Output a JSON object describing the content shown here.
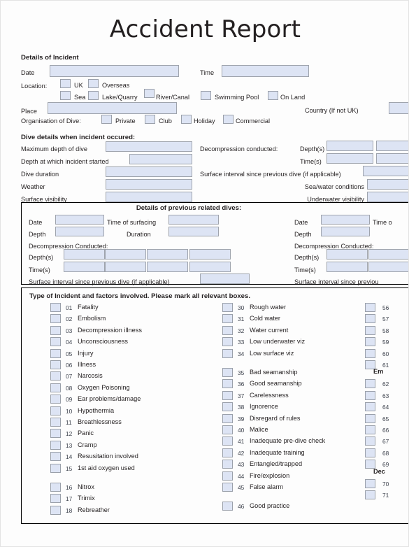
{
  "document": {
    "title": "Accident Report"
  },
  "sections": {
    "incident": {
      "heading": "Details of Incident",
      "date_label": "Date",
      "time_label": "Time",
      "location_label": "Location:",
      "location_options_row1": [
        "UK",
        "Overseas"
      ],
      "location_options_row2": [
        "Sea",
        "Lake/Quarry",
        "River/Canal",
        "Swimming Pool",
        "On Land"
      ],
      "place_label": "Place",
      "country_label": "Country (If not UK)",
      "organisation_label": "Organisation of Dive:",
      "organisation_options": [
        "Private",
        "Club",
        "Holiday",
        "Commercial"
      ]
    },
    "dive_details": {
      "heading": "Dive details when incident occured:",
      "left_labels": [
        "Maximum depth of dive",
        "Depth at which incident started",
        "Dive duration",
        "Weather",
        "Surface visibility"
      ],
      "right_labels": [
        "Decompression conducted:",
        "Depth(s)",
        "Time(s)",
        "Surface interval since previous dive (if applicable)",
        "Sea/water conditions",
        "Underwater visibility"
      ]
    },
    "previous_dives": {
      "heading": "Details of previous related dives:",
      "date_label": "Date",
      "time_of_surfacing_label": "Time of surfacing",
      "time_of_surfacing_label_clipped": "Time o",
      "depth_label": "Depth",
      "duration_label": "Duration",
      "decompression_label": "Decompression Conducted:",
      "depths_label": "Depth(s)",
      "times_label": "Time(s)",
      "surface_interval_label": "Surface interval since previous dive (if applicable)",
      "surface_interval_label_clipped": "Surface interval since previou"
    },
    "incident_types": {
      "heading": "Type of Incident and factors involved. Please mark all relevant boxes.",
      "column1": [
        {
          "num": "01",
          "label": "Fatality"
        },
        {
          "num": "02",
          "label": "Embolism"
        },
        {
          "num": "03",
          "label": "Decompression illness"
        },
        {
          "num": "04",
          "label": "Unconsciousness"
        },
        {
          "num": "05",
          "label": "Injury"
        },
        {
          "num": "06",
          "label": "Illness"
        },
        {
          "num": "07",
          "label": "Narcosis"
        },
        {
          "num": "08",
          "label": "Oxygen Poisoning"
        },
        {
          "num": "09",
          "label": "Ear problems/damage"
        },
        {
          "num": "10",
          "label": "Hypothermia"
        },
        {
          "num": "11",
          "label": "Breathlessness"
        },
        {
          "num": "12",
          "label": "Panic"
        },
        {
          "num": "13",
          "label": "Cramp"
        },
        {
          "num": "14",
          "label": "Resusitation involved"
        },
        {
          "num": "15",
          "label": "1st aid oxygen used"
        },
        {
          "num": "16",
          "label": "Nitrox",
          "gap_before": true
        },
        {
          "num": "17",
          "label": "Trimix"
        },
        {
          "num": "18",
          "label": "Rebreather"
        }
      ],
      "column2": [
        {
          "num": "30",
          "label": "Rough water"
        },
        {
          "num": "31",
          "label": "Cold water"
        },
        {
          "num": "32",
          "label": "Water current"
        },
        {
          "num": "33",
          "label": "Low underwater viz"
        },
        {
          "num": "34",
          "label": "Low surface viz"
        },
        {
          "num": "35",
          "label": "Bad seamanship",
          "gap_before": true
        },
        {
          "num": "36",
          "label": "Good seamanship"
        },
        {
          "num": "37",
          "label": "Carelessness"
        },
        {
          "num": "38",
          "label": "Ignorence"
        },
        {
          "num": "39",
          "label": "Disregard of rules"
        },
        {
          "num": "40",
          "label": "Malice"
        },
        {
          "num": "41",
          "label": "Inadequate pre-dive check"
        },
        {
          "num": "42",
          "label": "Inadequate training"
        },
        {
          "num": "43",
          "label": "Entangled/trapped"
        },
        {
          "num": "44",
          "label": "Fire/explosion"
        },
        {
          "num": "45",
          "label": "False alarm"
        },
        {
          "num": "46",
          "label": "Good practice",
          "gap_before": true
        }
      ],
      "column3": [
        {
          "num": "56"
        },
        {
          "num": "57"
        },
        {
          "num": "58"
        },
        {
          "num": "59"
        },
        {
          "num": "60"
        },
        {
          "num": "61"
        },
        {
          "num": "62",
          "group_header": "Em",
          "gap_before": true
        },
        {
          "num": "63"
        },
        {
          "num": "64"
        },
        {
          "num": "65"
        },
        {
          "num": "66"
        },
        {
          "num": "67"
        },
        {
          "num": "68"
        },
        {
          "num": "69"
        },
        {
          "num": "70",
          "group_header": "Dec",
          "gap_before": true
        },
        {
          "num": "71"
        }
      ]
    }
  },
  "colors": {
    "field_fill": "#dde4f4",
    "field_border": "#9fa4ad",
    "text": "#231f20",
    "page_bg": "#fdfdfd"
  }
}
